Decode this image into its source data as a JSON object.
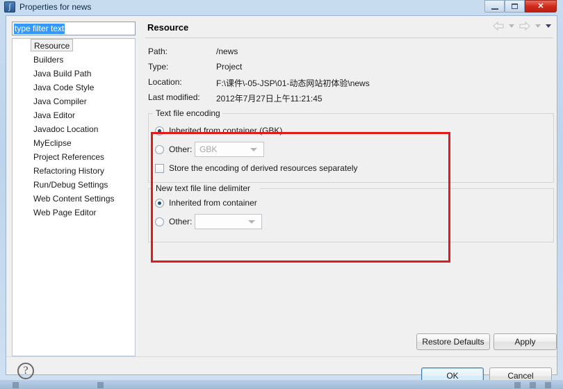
{
  "window": {
    "title": "Properties for news",
    "icon": "myeclipse-icon",
    "buttons": {
      "minimize": "minimize-icon",
      "maximize": "maximize-icon",
      "close": "✕"
    }
  },
  "sidebar": {
    "filter": {
      "value": "type filter text",
      "placeholder": "type filter text"
    },
    "items": [
      {
        "label": "Resource",
        "selected": true
      },
      {
        "label": "Builders",
        "selected": false
      },
      {
        "label": "Java Build Path",
        "selected": false
      },
      {
        "label": "Java Code Style",
        "selected": false
      },
      {
        "label": "Java Compiler",
        "selected": false
      },
      {
        "label": "Java Editor",
        "selected": false
      },
      {
        "label": "Javadoc Location",
        "selected": false
      },
      {
        "label": "MyEclipse",
        "selected": false
      },
      {
        "label": "Project References",
        "selected": false
      },
      {
        "label": "Refactoring History",
        "selected": false
      },
      {
        "label": "Run/Debug Settings",
        "selected": false
      },
      {
        "label": "Web Content Settings",
        "selected": false
      },
      {
        "label": "Web Page Editor",
        "selected": false
      }
    ]
  },
  "pane": {
    "title": "Resource",
    "nav": {
      "back": "back-arrow-icon",
      "back_menu": "chevron-down-icon",
      "forward": "forward-arrow-icon",
      "forward_menu": "chevron-down-icon",
      "menu": "chevron-down-icon"
    },
    "properties": [
      {
        "label": "Path:",
        "value": "/news"
      },
      {
        "label": "Type:",
        "value": "Project"
      },
      {
        "label": "Location:",
        "value": "F:\\课件\\-05-JSP\\01-动态网站初体验\\news"
      },
      {
        "label": "Last modified:",
        "value": "2012年7月27日上午11:21:45"
      }
    ],
    "encoding_group": {
      "title": "Text file encoding",
      "inherited": {
        "label": "Inherited from container (GBK)",
        "selected": true
      },
      "other": {
        "label": "Other:",
        "selected": false,
        "combo_value": "GBK",
        "disabled": true
      },
      "store_derived": {
        "label": "Store the encoding of derived resources separately",
        "checked": false
      }
    },
    "delimiter_group": {
      "title": "New text file line delimiter",
      "inherited": {
        "label": "Inherited from container",
        "selected": true
      },
      "other": {
        "label": "Other:",
        "selected": false,
        "combo_value": "",
        "disabled": true
      }
    },
    "restore_defaults_label": "Restore Defaults",
    "apply_label": "Apply"
  },
  "footer": {
    "help": "?",
    "ok_label": "OK",
    "cancel_label": "Cancel"
  },
  "annotation": {
    "color": "#e01b1b"
  }
}
